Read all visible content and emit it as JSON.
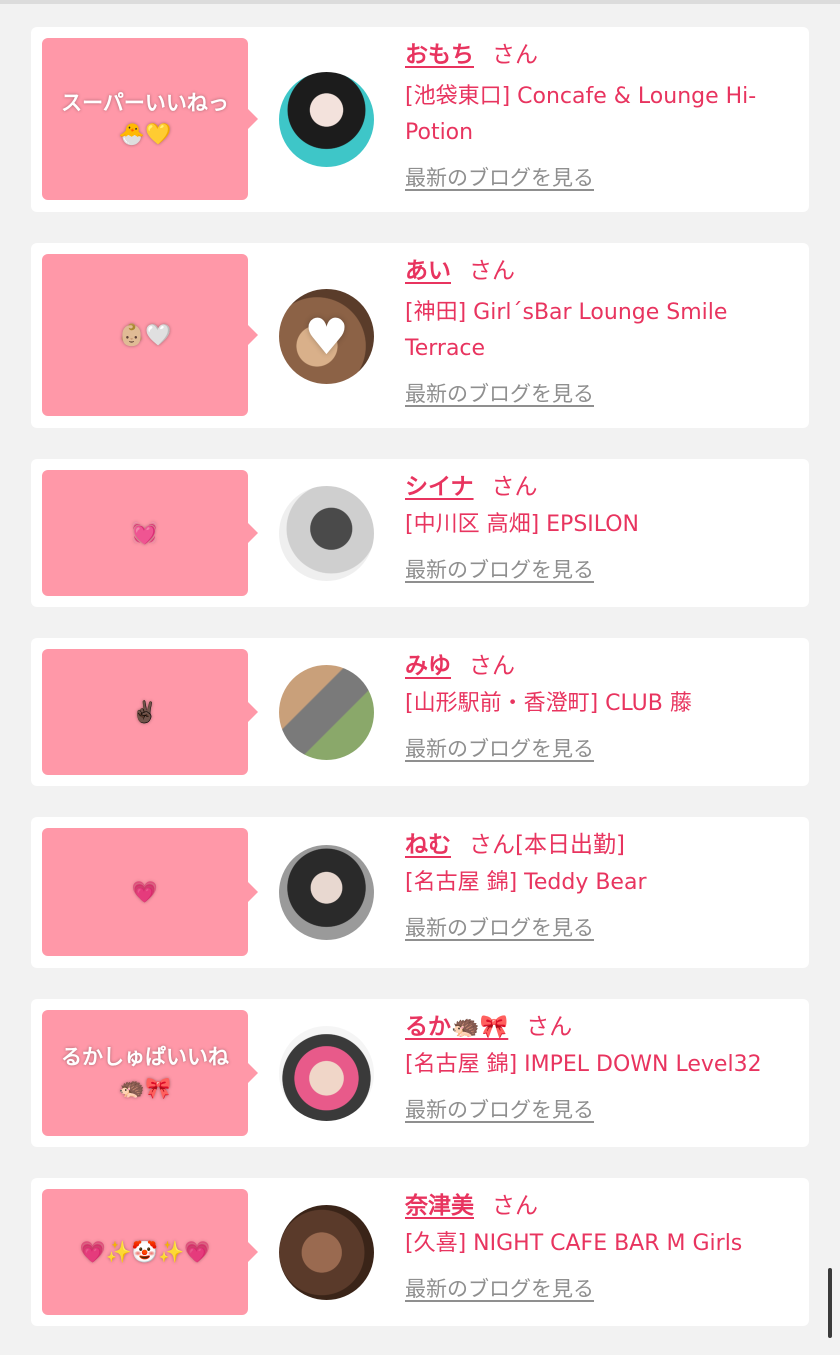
{
  "cards": [
    {
      "bubble": "スーパーいいねっ\n🐣💛",
      "name": "おもち",
      "san": "さん",
      "status": "",
      "shop": "[池袋東口] Concafe & Lounge Hi-Potion",
      "blog": "最新のブログを見る",
      "avatar_bg": "#3ec6c8",
      "avatar_heart": ""
    },
    {
      "bubble": "👶🏼🤍",
      "name": "あい",
      "san": "さん",
      "status": "",
      "shop": "[神田] Girl´sBar Lounge Smile Terrace",
      "blog": "最新のブログを見る",
      "avatar_bg": "#a4785a",
      "avatar_heart": "♥"
    },
    {
      "bubble": "💓",
      "name": "シイナ",
      "san": "さん",
      "status": "",
      "shop": "[中川区 高畑] EPSILON",
      "blog": "最新のブログを見る",
      "avatar_bg": "#d9d9d9",
      "avatar_heart": ""
    },
    {
      "bubble": "✌🏿",
      "name": "みゆ",
      "san": "さん",
      "status": "",
      "shop": "[山形駅前・香澄町] CLUB 藤",
      "blog": "最新のブログを見る",
      "avatar_bg": "#a2906c",
      "avatar_heart": ""
    },
    {
      "bubble": "💗",
      "name": "ねむ",
      "san": "さん",
      "status": "[本日出勤]",
      "shop": "[名古屋 錦] Teddy Bear",
      "blog": "最新のブログを見る",
      "avatar_bg": "#6a6a6a",
      "avatar_heart": ""
    },
    {
      "bubble": "るかしゅぱいいね\n🦔🎀",
      "name": "るか🦔🎀",
      "san": "さん",
      "status": "",
      "shop": "[名古屋 錦] IMPEL DOWN Level32",
      "blog": "最新のブログを見る",
      "avatar_bg": "#e85a8a",
      "avatar_heart": ""
    },
    {
      "bubble": "💗✨🤡✨💗",
      "name": "奈津美",
      "san": "さん",
      "status": "",
      "shop": "[久喜] NIGHT CAFE BAR M Girls",
      "blog": "最新のブログを見る",
      "avatar_bg": "#6b4a36",
      "avatar_heart": ""
    }
  ]
}
